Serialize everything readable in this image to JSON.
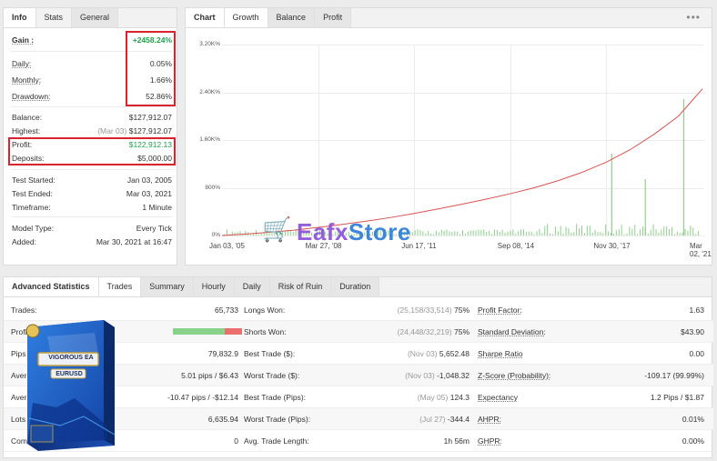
{
  "info": {
    "tabs": [
      "Info",
      "Stats",
      "General"
    ],
    "gain": {
      "label": "Gain :",
      "value": "+2458.24%"
    },
    "daily": {
      "label": "Daily:",
      "value": "0.05%"
    },
    "monthly": {
      "label": "Monthly:",
      "value": "1.66%"
    },
    "drawdown": {
      "label": "Drawdown:",
      "value": "52.86%"
    },
    "balance": {
      "label": "Balance:",
      "value": "$127,912.07"
    },
    "highest": {
      "label": "Highest:",
      "date": "(Mar 03)",
      "value": "$127,912.07"
    },
    "profit": {
      "label": "Profit:",
      "value": "$122,912.13"
    },
    "deposits": {
      "label": "Deposits:",
      "value": "$5,000.00"
    },
    "test_started": {
      "label": "Test Started:",
      "value": "Jan 03, 2005"
    },
    "test_ended": {
      "label": "Test Ended:",
      "value": "Mar 03, 2021"
    },
    "timeframe": {
      "label": "Timeframe:",
      "value": "1 Minute"
    },
    "model_type": {
      "label": "Model Type:",
      "value": "Every Tick"
    },
    "added": {
      "label": "Added:",
      "value": "Mar 30, 2021 at 16:47"
    }
  },
  "chart": {
    "tabs": [
      "Chart",
      "Growth",
      "Balance",
      "Profit"
    ],
    "menu_icon": "ellipsis-icon",
    "colors": {
      "growth_line": "#d9534f",
      "volume_bars": "#8ed08b"
    }
  },
  "chart_data": {
    "type": "line",
    "title": "",
    "yticks": [
      "0%",
      "800%",
      "1.60K%",
      "2.40K%",
      "3.20K%"
    ],
    "xticks": [
      "Jan 03, '05",
      "Mar 27, '08",
      "Jun 17, '11",
      "Sep 08, '14",
      "Nov 30, '17",
      "Mar 02, '21"
    ],
    "ylim": [
      0,
      3200
    ],
    "x": [
      0,
      1,
      2,
      3,
      4,
      5,
      6,
      7,
      8,
      9,
      10,
      11,
      12,
      13,
      14,
      15,
      16,
      17,
      18,
      19,
      20
    ],
    "series": [
      {
        "values": [
          0,
          25,
          55,
          90,
          135,
          185,
          240,
          300,
          370,
          445,
          525,
          610,
          700,
          800,
          920,
          1060,
          1230,
          1440,
          1700,
          2000,
          2458
        ]
      }
    ],
    "grid": true
  },
  "watermark": {
    "brand_a": "Eafx",
    "brand_b": "Store",
    "icon": "shopping-cart-icon"
  },
  "product_box": {
    "title": "VIGOROUS EA",
    "pair": "EURUSD"
  },
  "stats": {
    "tabs": [
      "Advanced Statistics",
      "Trades",
      "Summary",
      "Hourly",
      "Daily",
      "Risk of Ruin",
      "Duration"
    ],
    "rows": [
      {
        "l1": "Trades:",
        "v1": "65,733",
        "l2": "Longs Won:",
        "n2": "(25,158/33,514)",
        "v2": "75%",
        "l3": "Profit Factor:",
        "v3": "1.63"
      },
      {
        "l1": "Profit",
        "v1": "",
        "l2": "Shorts Won:",
        "n2": "(24,448/32,219)",
        "v2": "75%",
        "l3": "Standard Deviation:",
        "v3": "$43.90"
      },
      {
        "l1": "Pips",
        "v1": "79,832.9",
        "l2": "Best Trade ($):",
        "n2": "(Nov 03)",
        "v2": "5,652.48",
        "l3": "Sharpe Ratio",
        "v3": "0.00"
      },
      {
        "l1": "Aver",
        "v1": "5.01 pips / $6.43",
        "l2": "Worst Trade ($):",
        "n2": "(Nov 03)",
        "v2": "-1,048.32",
        "l3": "Z-Score (Probability):",
        "v3": "-109.17 (99.99%)"
      },
      {
        "l1": "Aver",
        "v1": "-10.47 pips / -$12.14",
        "l2": "Best Trade (Pips):",
        "n2": "(May 05)",
        "v2": "124.3",
        "l3": "Expectancy",
        "v3": "1.2 Pips / $1.87"
      },
      {
        "l1": "Lots",
        "v1": "6,635.94",
        "l2": "Worst Trade (Pips):",
        "n2": "(Jul 27)",
        "v2": "-344.4",
        "l3": "AHPR:",
        "v3": "0.01%"
      },
      {
        "l1": "Com",
        "v1": "0",
        "l2": "Avg. Trade Length:",
        "n2": "",
        "v2": "1h 56m",
        "l3": "GHPR:",
        "v3": "0.00%"
      }
    ],
    "shorts_won_fraction": 0.75
  }
}
